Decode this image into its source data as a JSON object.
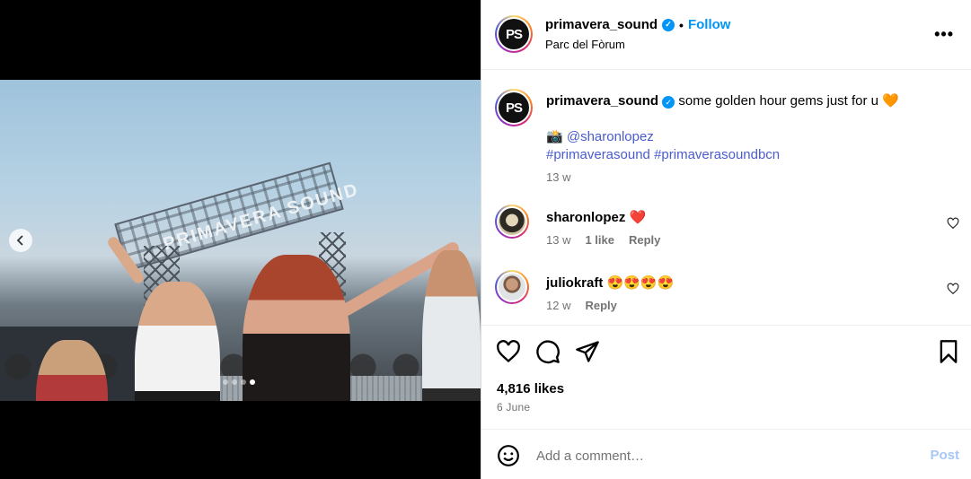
{
  "header": {
    "avatar_text": "PS",
    "username": "primavera_sound",
    "separator": "•",
    "follow_label": "Follow",
    "location": "Parc del Fòrum",
    "more_icon": "more-horizontal-icon"
  },
  "media": {
    "stage_text": "PRIMAVERA SOUND",
    "prev_icon": "chevron-left-icon",
    "dot_count": 4,
    "active_dot": 3
  },
  "caption": {
    "avatar_text": "PS",
    "username": "primavera_sound",
    "text": "some golden hour gems just for u 🧡",
    "camera_emoji": "📸",
    "mention": "@sharonlopez",
    "hashtags": "#primaverasound #primaverasoundbcn",
    "time": "13 w"
  },
  "comments": [
    {
      "username": "sharonlopez",
      "text": "❤️",
      "time": "13 w",
      "likes": "1 like",
      "reply": "Reply"
    },
    {
      "username": "juliokraft",
      "text": "😍😍😍😍",
      "time": "12 w",
      "reply": "Reply"
    }
  ],
  "actions": {
    "like_icon": "heart-icon",
    "comment_icon": "comment-icon",
    "share_icon": "share-icon",
    "save_icon": "bookmark-icon"
  },
  "likes": "4,816 likes",
  "date": "6 June",
  "add_comment": {
    "emoji_icon": "emoji-icon",
    "placeholder": "Add a comment…",
    "post_label": "Post"
  },
  "colors": {
    "accent": "#0095f6",
    "post_disabled": "#a7c7f5",
    "link": "#4a5cd0",
    "secondary_text": "#737373"
  }
}
